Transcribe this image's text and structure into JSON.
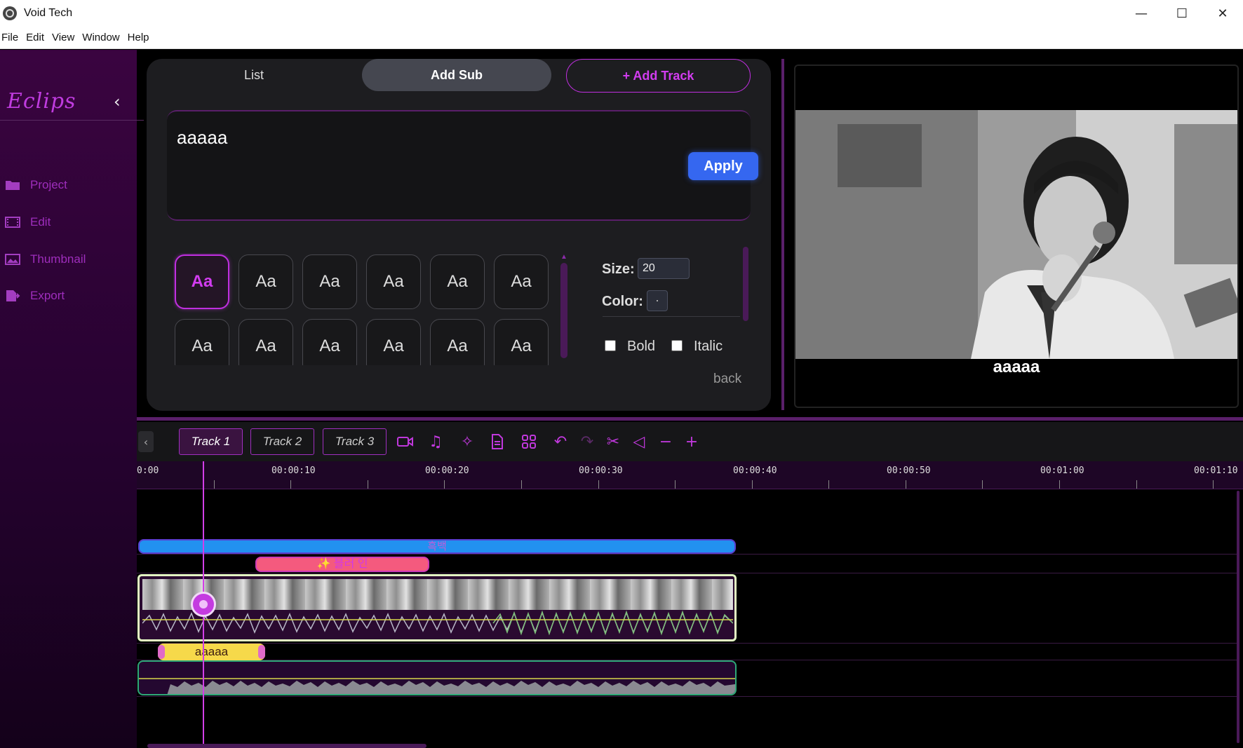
{
  "window": {
    "title": "Void Tech",
    "controls": [
      "—",
      "☐",
      "✕"
    ]
  },
  "menu": [
    "File",
    "Edit",
    "View",
    "Window",
    "Help"
  ],
  "sidebar": {
    "logo": "Eclips",
    "items": [
      {
        "label": "Project",
        "icon": "folder-icon"
      },
      {
        "label": "Edit",
        "icon": "film-icon"
      },
      {
        "label": "Thumbnail",
        "icon": "image-icon"
      },
      {
        "label": "Export",
        "icon": "export-icon"
      }
    ]
  },
  "editor": {
    "tabs": {
      "list": "List",
      "add_sub": "Add Sub"
    },
    "add_track": "+ Add Track",
    "subtitle_text": "aaaaa",
    "apply": "Apply",
    "font_sample": "Aa",
    "size_label": "Size:",
    "size_value": "20",
    "color_label": "Color:",
    "bold_label": "Bold",
    "italic_label": "Italic",
    "back": "back"
  },
  "preview": {
    "caption": "aaaaa"
  },
  "timeline": {
    "tracks": [
      "Track 1",
      "Track 2",
      "Track 3"
    ],
    "active_track": "Track 1",
    "tools": [
      "video-icon",
      "music-icon",
      "sparkle-icon",
      "document-icon",
      "grid-icon",
      "undo-icon",
      "redo-icon",
      "scissors-icon",
      "trim-icon",
      "zoom-out-icon",
      "zoom-in-icon"
    ],
    "ruler": [
      "0:00",
      "00:00:10",
      "00:00:20",
      "00:00:30",
      "00:00:40",
      "00:00:50",
      "00:01:00",
      "00:01:10"
    ],
    "clips": {
      "effect_bw": "흑백",
      "effect_blur": "✨ 블러 인",
      "subtitle": "aaaaa"
    }
  },
  "colors": {
    "accent": "#c02fe0",
    "apply": "#3567f0",
    "blue_clip": "#2291f0",
    "pink_clip": "#f45a7e",
    "yellow_clip": "#f6d94a"
  }
}
